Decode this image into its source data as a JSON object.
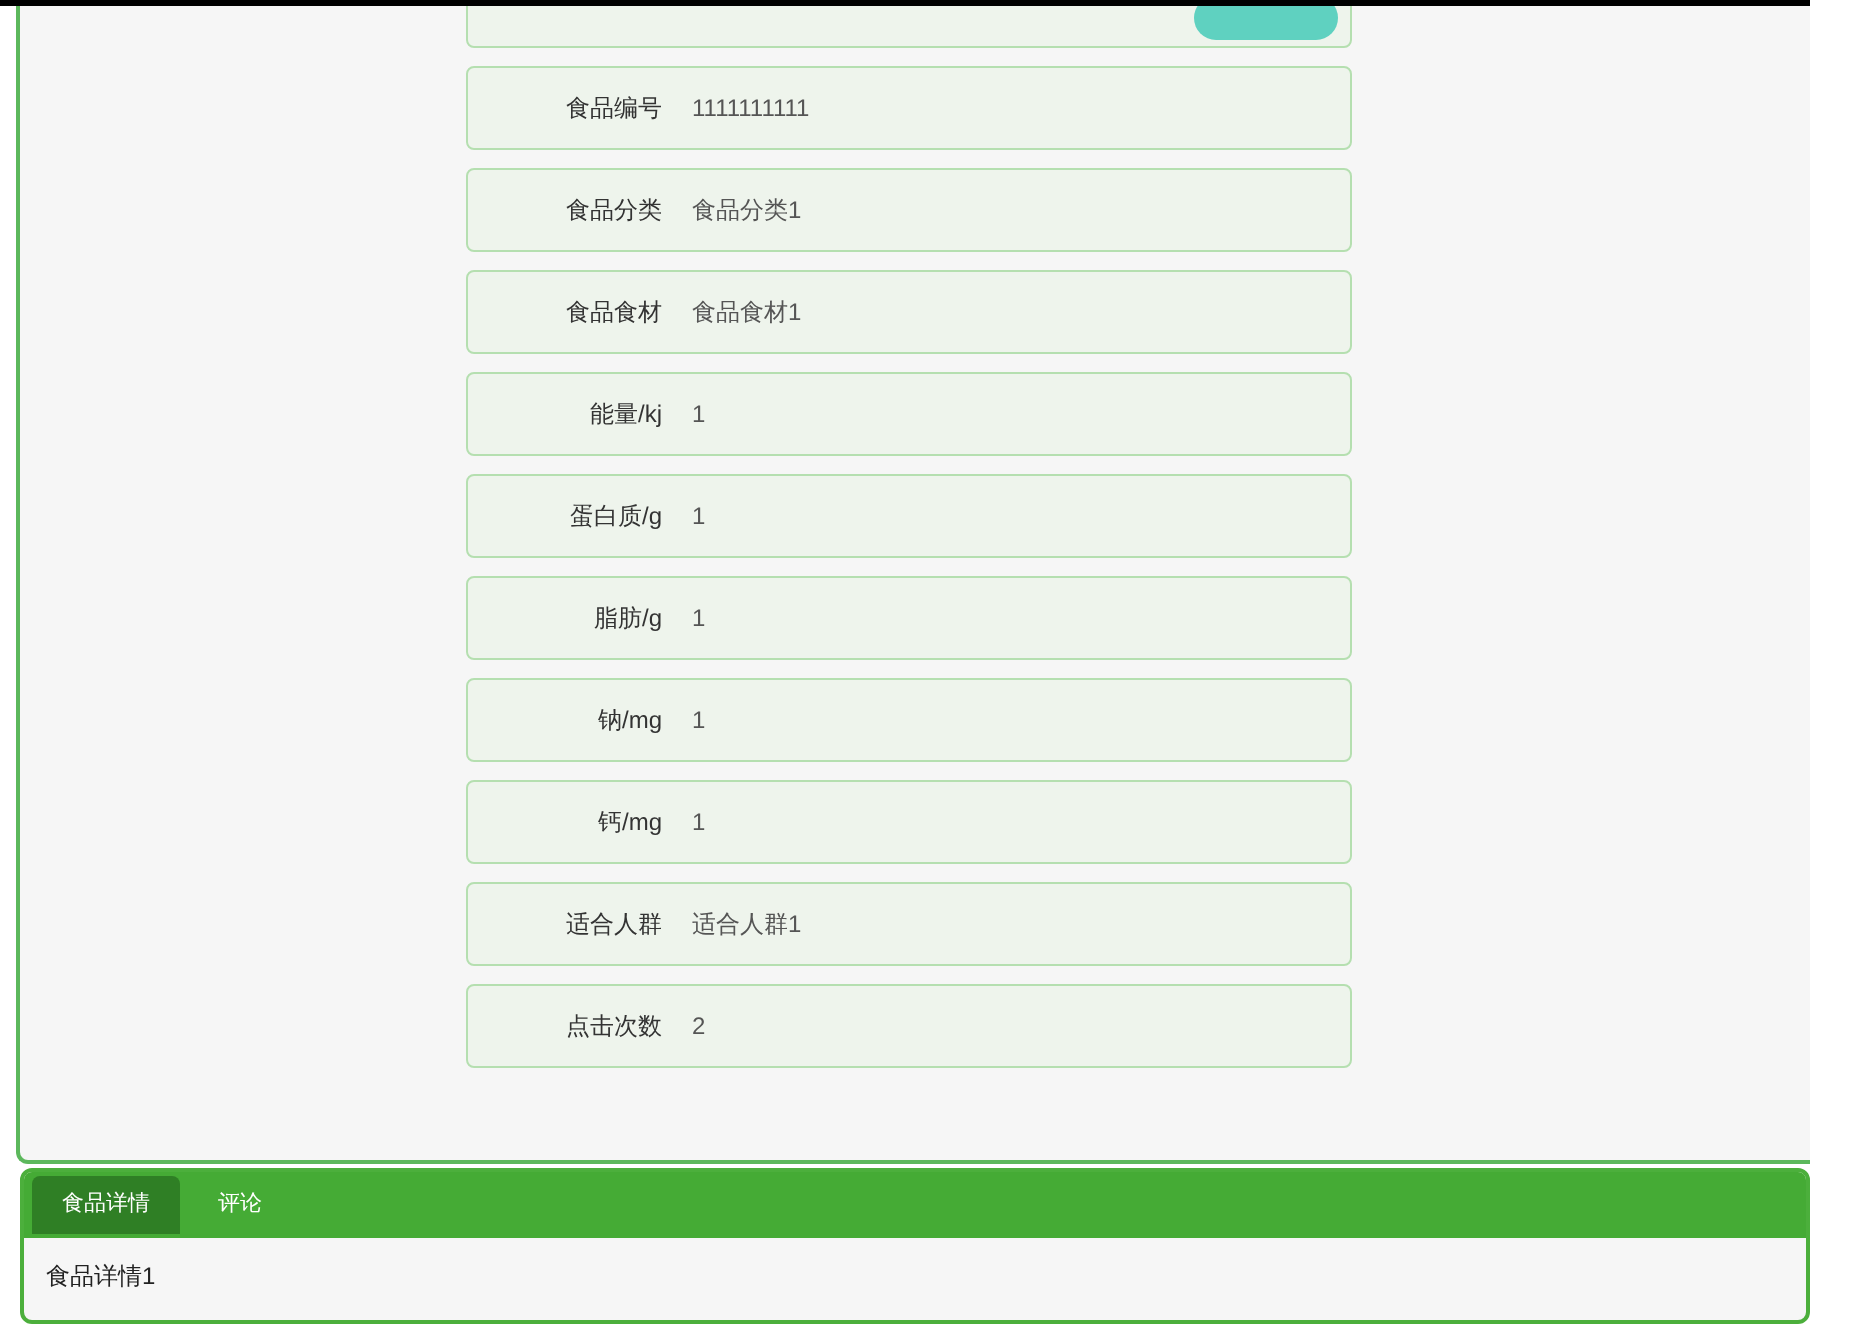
{
  "fields": [
    {
      "label": "食品编号",
      "value": "1111111111"
    },
    {
      "label": "食品分类",
      "value": "食品分类1"
    },
    {
      "label": "食品食材",
      "value": "食品食材1"
    },
    {
      "label": "能量/kj",
      "value": "1"
    },
    {
      "label": "蛋白质/g",
      "value": "1"
    },
    {
      "label": "脂肪/g",
      "value": "1"
    },
    {
      "label": "钠/mg",
      "value": "1"
    },
    {
      "label": "钙/mg",
      "value": "1"
    },
    {
      "label": "适合人群",
      "value": "适合人群1"
    },
    {
      "label": "点击次数",
      "value": "2"
    }
  ],
  "tabs": [
    {
      "label": "食品详情",
      "selected": true
    },
    {
      "label": "评论",
      "selected": false
    }
  ],
  "tab_content": "食品详情1"
}
